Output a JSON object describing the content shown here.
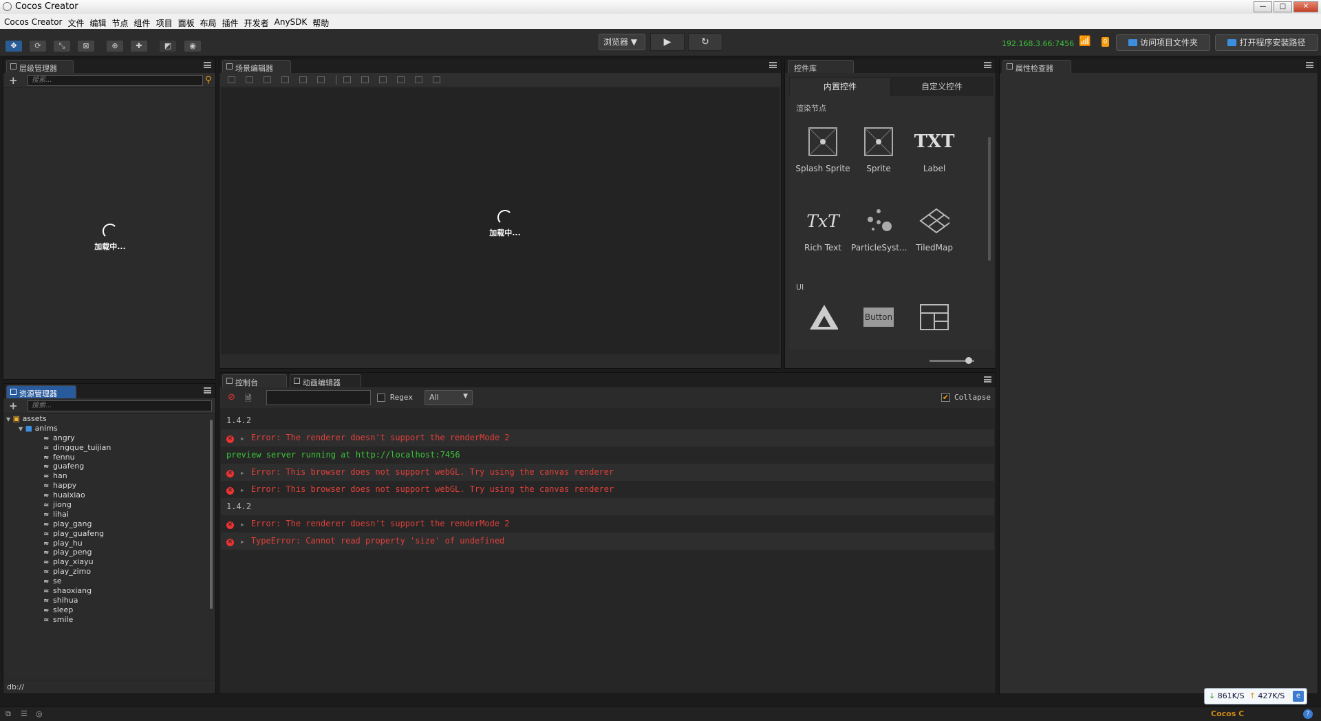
{
  "window": {
    "title": "Cocos Creator"
  },
  "menubar": {
    "items": [
      "Cocos Creator",
      "文件",
      "编辑",
      "节点",
      "组件",
      "项目",
      "面板",
      "布局",
      "插件",
      "开发者",
      "AnySDK",
      "帮助"
    ]
  },
  "toolbar": {
    "browser_select": "浏览器 ▼",
    "play": "▶",
    "refresh": "↻",
    "ip": "192.168.3.66:7456",
    "badge": "0",
    "open_project_folder": "访问项目文件夹",
    "open_install_path": "打开程序安装路径"
  },
  "hierarchy": {
    "tab": "层级管理器",
    "search_placeholder": "搜索...",
    "loading": "加载中..."
  },
  "scene": {
    "tab": "场景编辑器",
    "loading": "加载中..."
  },
  "library": {
    "tab": "控件库",
    "tabs": [
      "内置控件",
      "自定义控件"
    ],
    "section_render": "渲染节点",
    "section_ui": "UI",
    "items": [
      "Splash Sprite",
      "Sprite",
      "Label",
      "Rich Text",
      "ParticleSyst...",
      "TiledMap"
    ],
    "label_icon_text": "TXT",
    "richtext_icon_text": "TxT",
    "button_icon_text": "Button"
  },
  "inspector": {
    "tab": "属性检查器"
  },
  "assets": {
    "tab": "资源管理器",
    "search_placeholder": "搜索...",
    "root": "assets",
    "folder": "anims",
    "files": [
      "angry",
      "dingque_tuijian",
      "fennu",
      "guafeng",
      "han",
      "happy",
      "huaixiao",
      "jiong",
      "lihai",
      "play_gang",
      "play_guafeng",
      "play_hu",
      "play_peng",
      "play_xiayu",
      "play_zimo",
      "se",
      "shaoxiang",
      "shihua",
      "sleep",
      "smile"
    ],
    "status": "db://"
  },
  "console": {
    "tab": "控制台",
    "anim_tab": "动画编辑器",
    "regex_label": "Regex",
    "filter_select": "All",
    "collapse_label": "Collapse",
    "lines": [
      {
        "type": "log",
        "text": "1.4.2"
      },
      {
        "type": "error",
        "text": "Error: The renderer doesn't support the renderMode 2"
      },
      {
        "type": "info",
        "text": "preview server running at http://localhost:7456"
      },
      {
        "type": "error",
        "text": "Error: This browser does not support webGL. Try using the canvas renderer"
      },
      {
        "type": "error",
        "text": "Error: This browser does not support webGL. Try using the canvas renderer"
      },
      {
        "type": "log",
        "text": "1.4.2"
      },
      {
        "type": "error",
        "text": "Error: The renderer doesn't support the renderMode 2"
      },
      {
        "type": "error",
        "text": "TypeError: Cannot read property 'size' of undefined"
      }
    ]
  },
  "network": {
    "down": "861K/S",
    "up": "427K/S"
  },
  "taskbar": {
    "app_label": "Cocos C"
  },
  "colors": {
    "accent": "#285a9c",
    "error": "#e0403a",
    "success": "#3ac43a",
    "bg": "#2b2b2b"
  }
}
